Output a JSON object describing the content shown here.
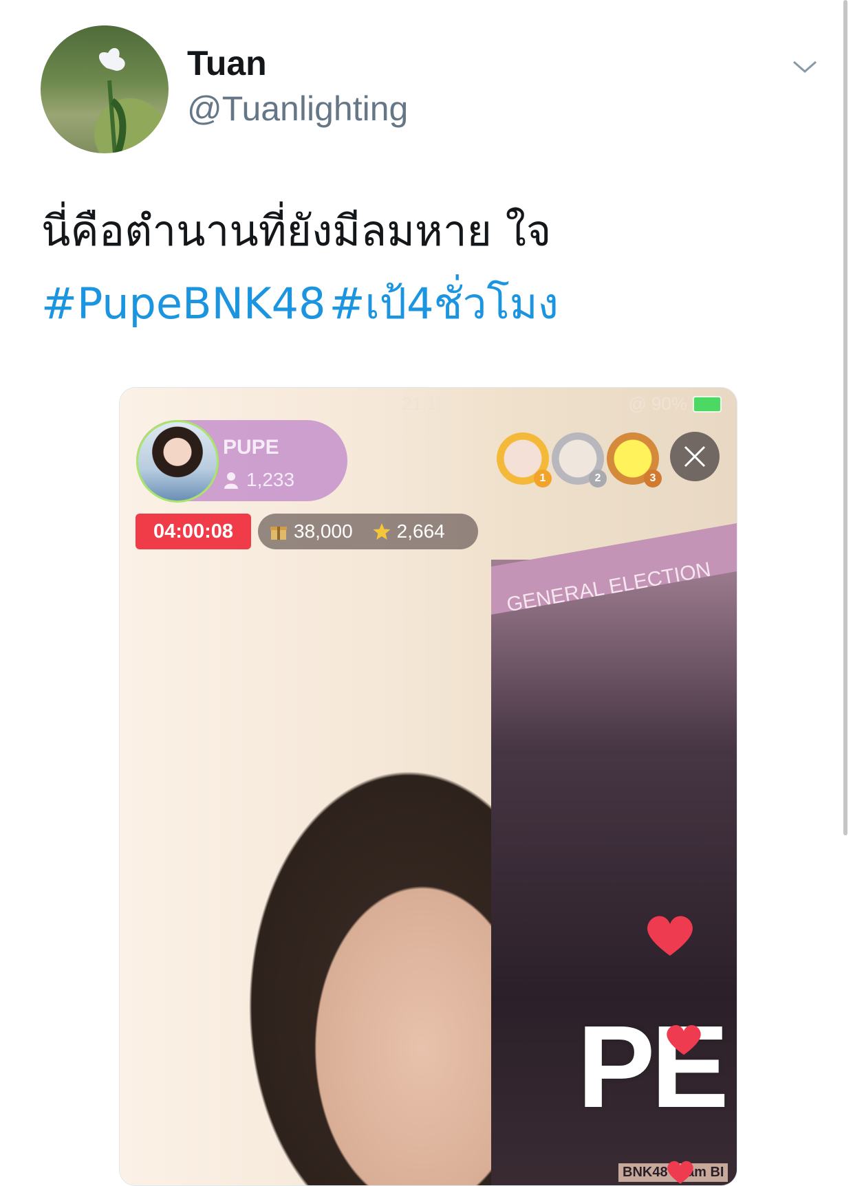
{
  "tweet": {
    "display_name": "Tuan",
    "handle": "@Tuanlighting",
    "text": "นี่คือตำนานที่ยังมีลมหาย ใจ",
    "hashtags": [
      "#PupeBNK48",
      "#เป้4ชั่วโมง"
    ],
    "menu_icon": "chevron-down-icon",
    "avatar_icon": "profile-photo"
  },
  "media": {
    "status_time": "21:15",
    "battery_text": "@ 90%",
    "poster_title": "GENERAL ELECTION",
    "poster_big_text": "PE",
    "poster_team_text": "BNK48 Team BI",
    "live": {
      "host_name": "PUPE",
      "viewers": "1,233",
      "timer": "04:00:08",
      "gifts": "38,000",
      "stars": "2,664",
      "ranks": [
        "1",
        "2",
        "3"
      ]
    }
  },
  "colors": {
    "hashtag": "#1b95e0",
    "handle": "#657786",
    "timer_bg": "#f03c48",
    "host_pill": "#c692cd"
  }
}
